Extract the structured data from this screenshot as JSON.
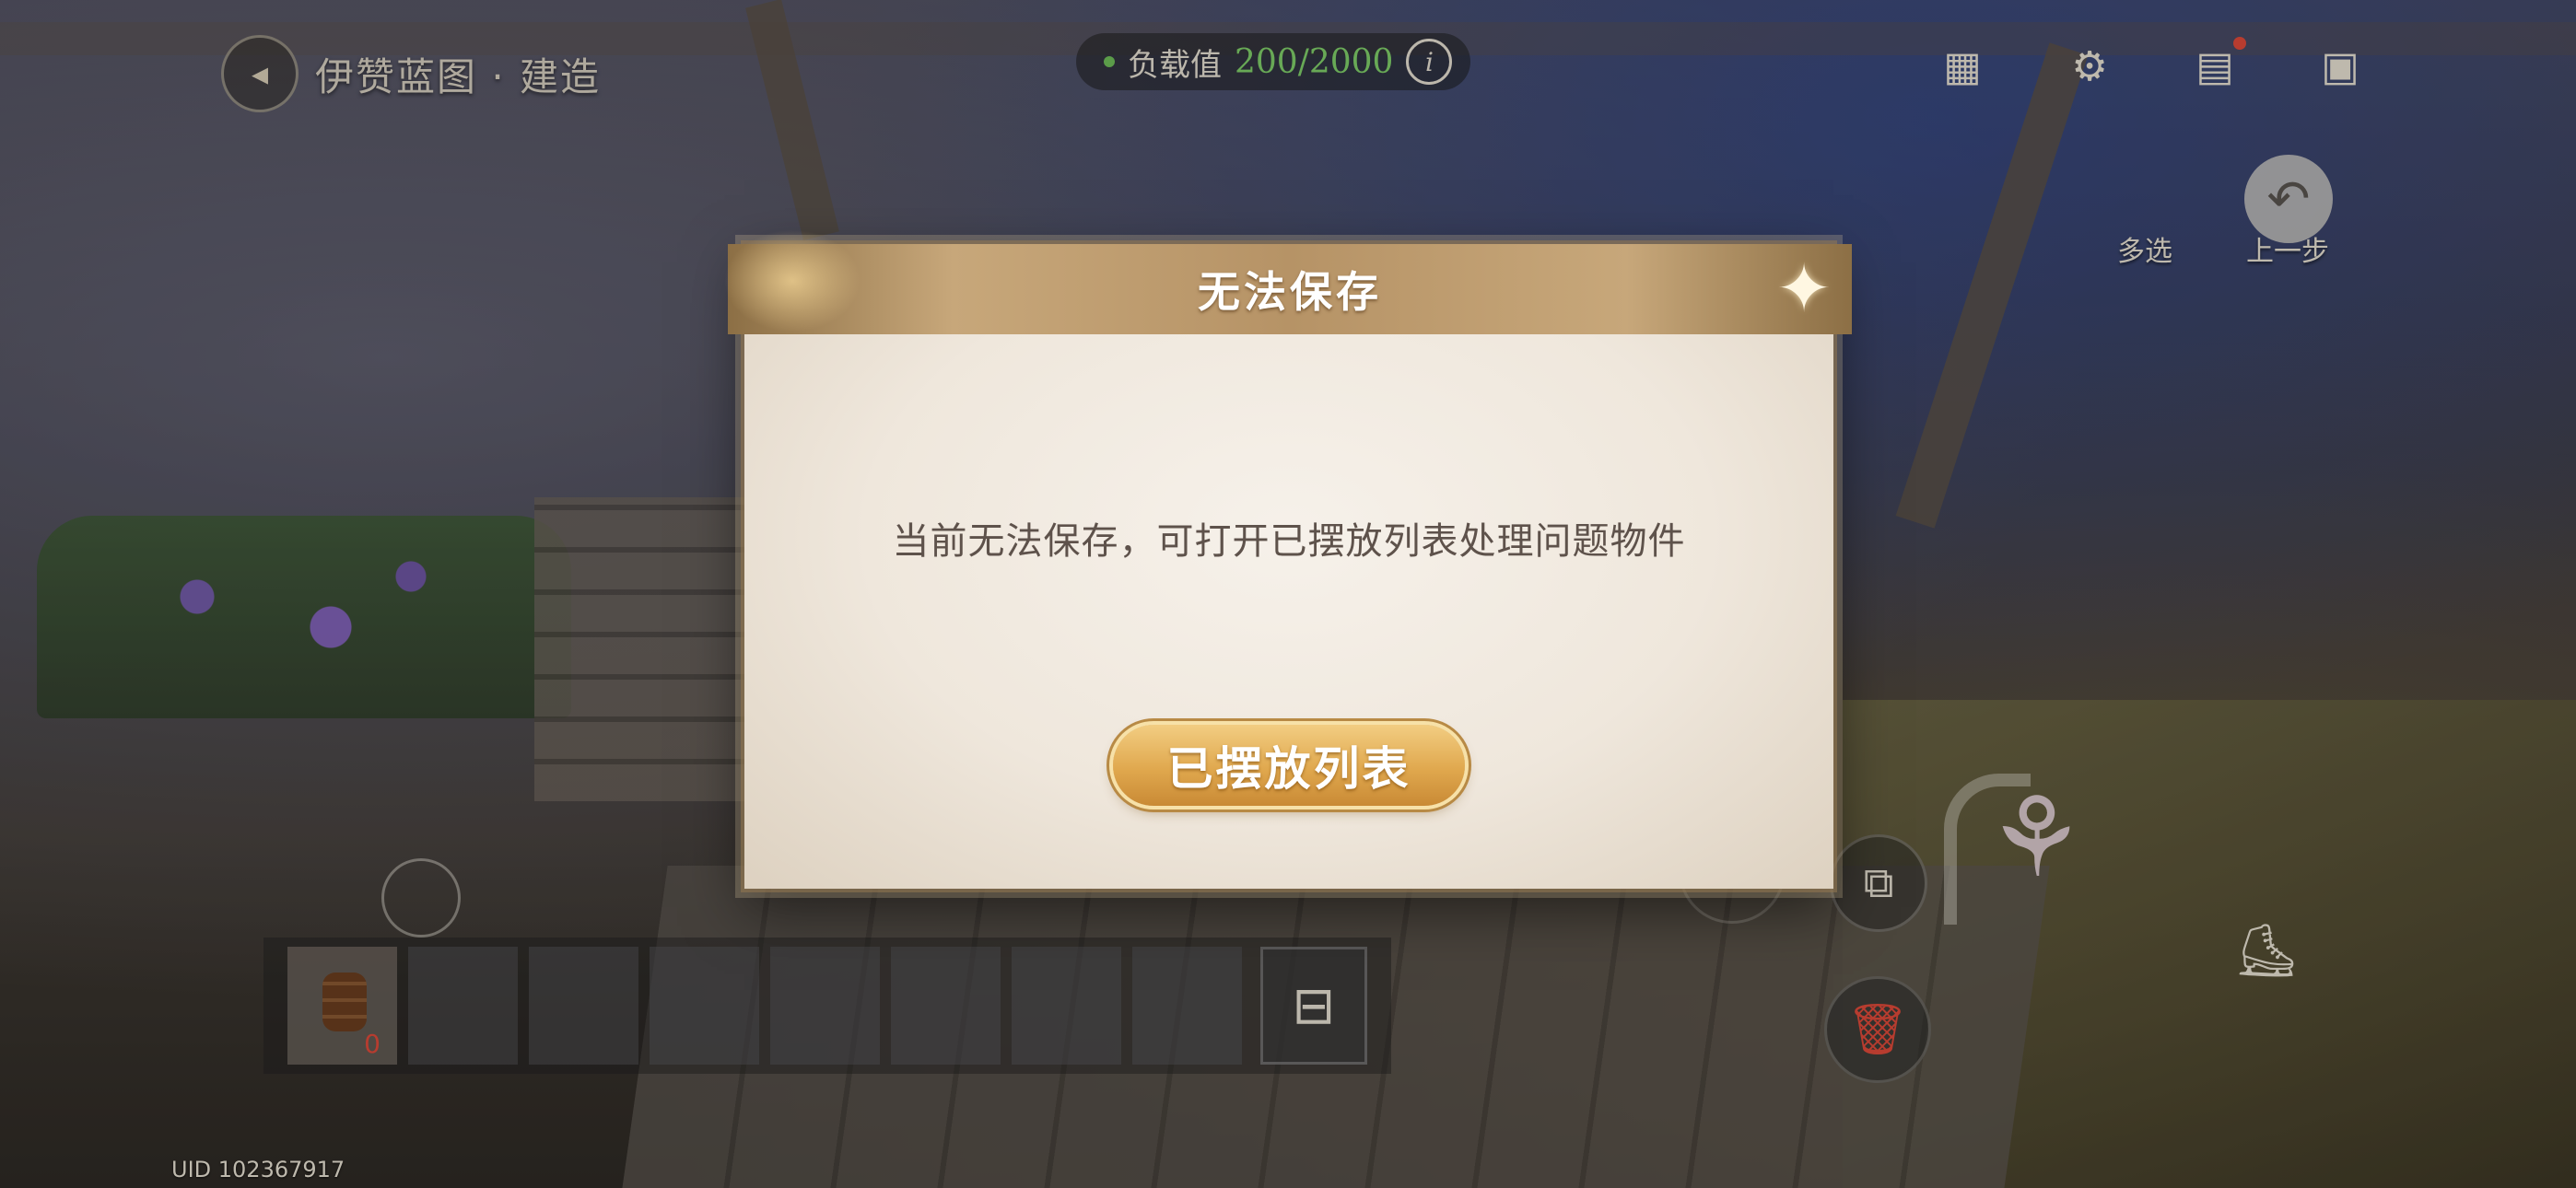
{
  "header": {
    "title": "伊赞蓝图 · 建造",
    "load_label": "负载值",
    "load_value": "200/2000",
    "info_glyph": "i"
  },
  "toolbar": {
    "multiselect_label": "多选",
    "undo_label": "上一步"
  },
  "dialog": {
    "title": "无法保存",
    "message": "当前无法保存，可打开已摆放列表处理问题物件",
    "button_label": "已摆放列表"
  },
  "hotbar": {
    "slots": [
      {
        "item": "barrel-icon",
        "count": "0"
      },
      {
        "item": null
      },
      {
        "item": null
      },
      {
        "item": null
      },
      {
        "item": null
      },
      {
        "item": null
      },
      {
        "item": null
      },
      {
        "item": null
      }
    ]
  },
  "footer": {
    "uid": "UID 102367917"
  },
  "colors": {
    "load_value": "#7fcf6a",
    "accent_gold": "#e0a84e",
    "delete_red": "#e04a3a"
  }
}
